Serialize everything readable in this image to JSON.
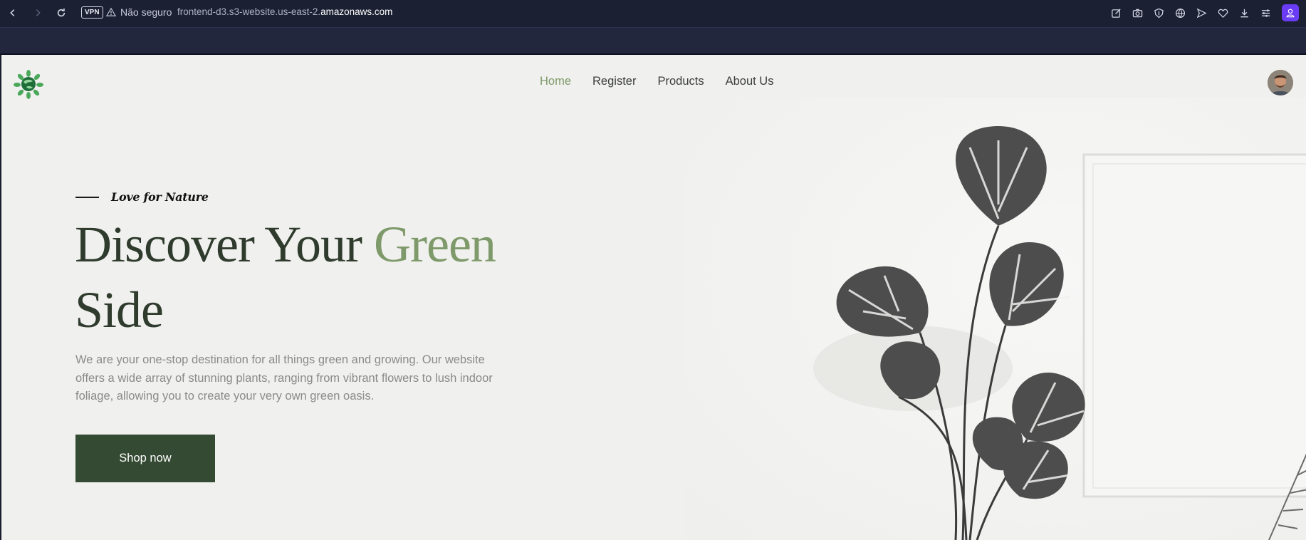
{
  "browser": {
    "vpn_label": "VPN",
    "security_label": "Não seguro",
    "url_prefix": "frontend-d3.s3-website.us-east-2.",
    "url_domain": "amazonaws.com",
    "toolbar_icons": [
      "edit-icon",
      "camera-icon",
      "shield-icon",
      "globe-icon",
      "send-icon",
      "heart-icon",
      "download-icon",
      "menu-icon"
    ],
    "accent_color": "#6b3cf5"
  },
  "site": {
    "nav": [
      {
        "label": "Home",
        "active": true
      },
      {
        "label": "Register",
        "active": false
      },
      {
        "label": "Products",
        "active": false
      },
      {
        "label": "About Us",
        "active": false
      }
    ]
  },
  "hero": {
    "tagline": "Love for Nature",
    "headline_part1": "Discover Your ",
    "headline_accent": "Green",
    "headline_part2": "Side",
    "description": "We are your one-stop destination for all things green and growing. Our website offers a wide array of stunning plants, ranging from vibrant flowers to lush indoor foliage, allowing you to create your very own green oasis.",
    "cta_label": "Shop now",
    "colors": {
      "dark_green": "#344a33",
      "accent_green": "#7f9a6a"
    }
  }
}
